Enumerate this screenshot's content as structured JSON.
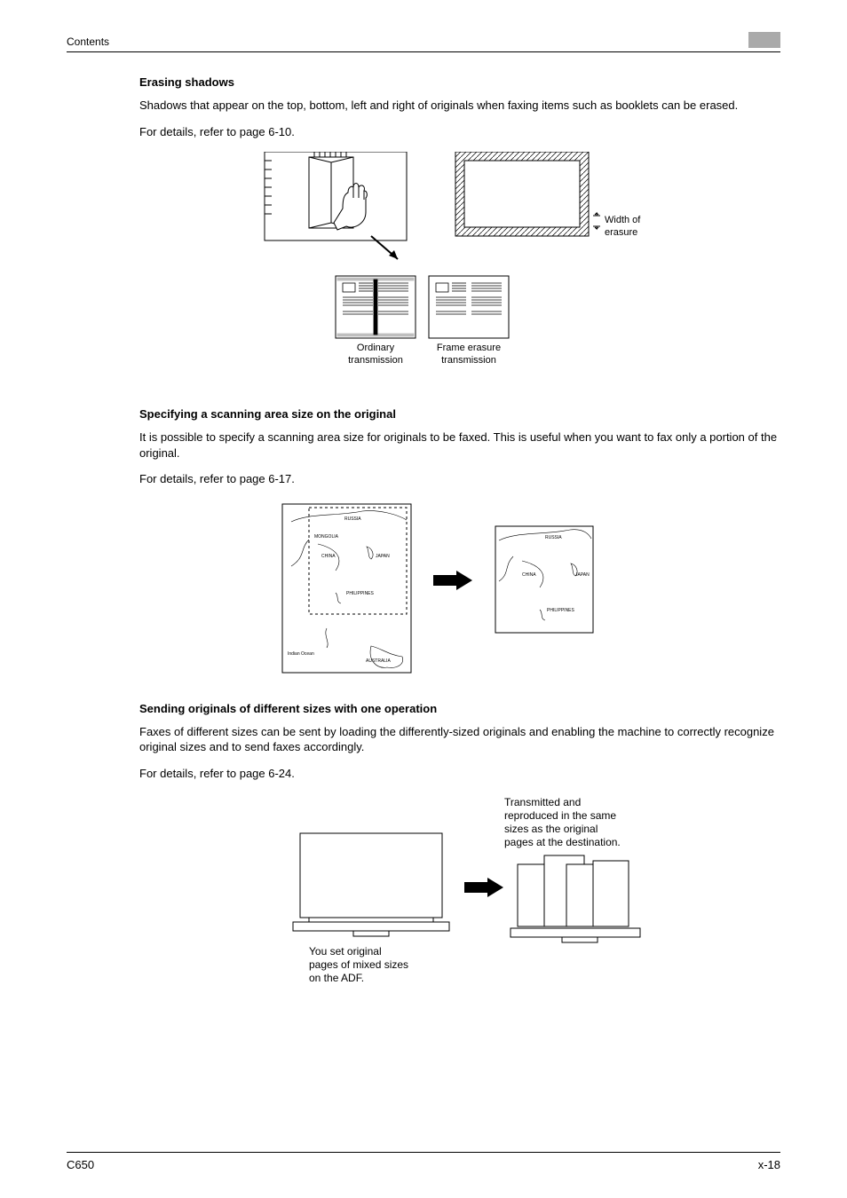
{
  "header": {
    "section": "Contents"
  },
  "sections": {
    "s1": {
      "title": "Erasing shadows",
      "p1": "Shadows that appear on the top, bottom, left and right of originals when faxing items such as booklets can be erased.",
      "p2": "For details, refer to page 6-10."
    },
    "s2": {
      "title": "Specifying a scanning area size on the original",
      "p1": "It is possible to specify a scanning area size for originals to be faxed. This is useful when you want to fax only a portion of the original.",
      "p2": "For details, refer to page 6-17."
    },
    "s3": {
      "title": "Sending originals of different sizes with one operation",
      "p1": "Faxes of different sizes can be sent by loading the differently-sized originals and enabling the machine to correctly recognize original sizes and to send faxes accordingly.",
      "p2": "For details, refer to page 6-24."
    }
  },
  "figures": {
    "f1": {
      "width_label_a": "Width of",
      "width_label_b": "erasure",
      "ordinary_a": "Ordinary",
      "ordinary_b": "transmission",
      "frame_a": "Frame erasure",
      "frame_b": "transmission"
    },
    "f2": {
      "map_labels": {
        "russia": "RUSSIA",
        "china": "CHINA",
        "japan": "JAPAN",
        "mongolia": "MONGOLIA",
        "philippines": "PHILIPPINES",
        "australia": "AUSTRALIA",
        "indian": "Indian Ocean"
      }
    },
    "f3": {
      "caption_top_a": "Transmitted and",
      "caption_top_b": "reproduced in the same",
      "caption_top_c": "sizes as the original",
      "caption_top_d": "pages at the destination.",
      "caption_bottom_a": "You set original",
      "caption_bottom_b": "pages of mixed sizes",
      "caption_bottom_c": "on the ADF."
    }
  },
  "footer": {
    "model": "C650",
    "page": "x-18"
  }
}
